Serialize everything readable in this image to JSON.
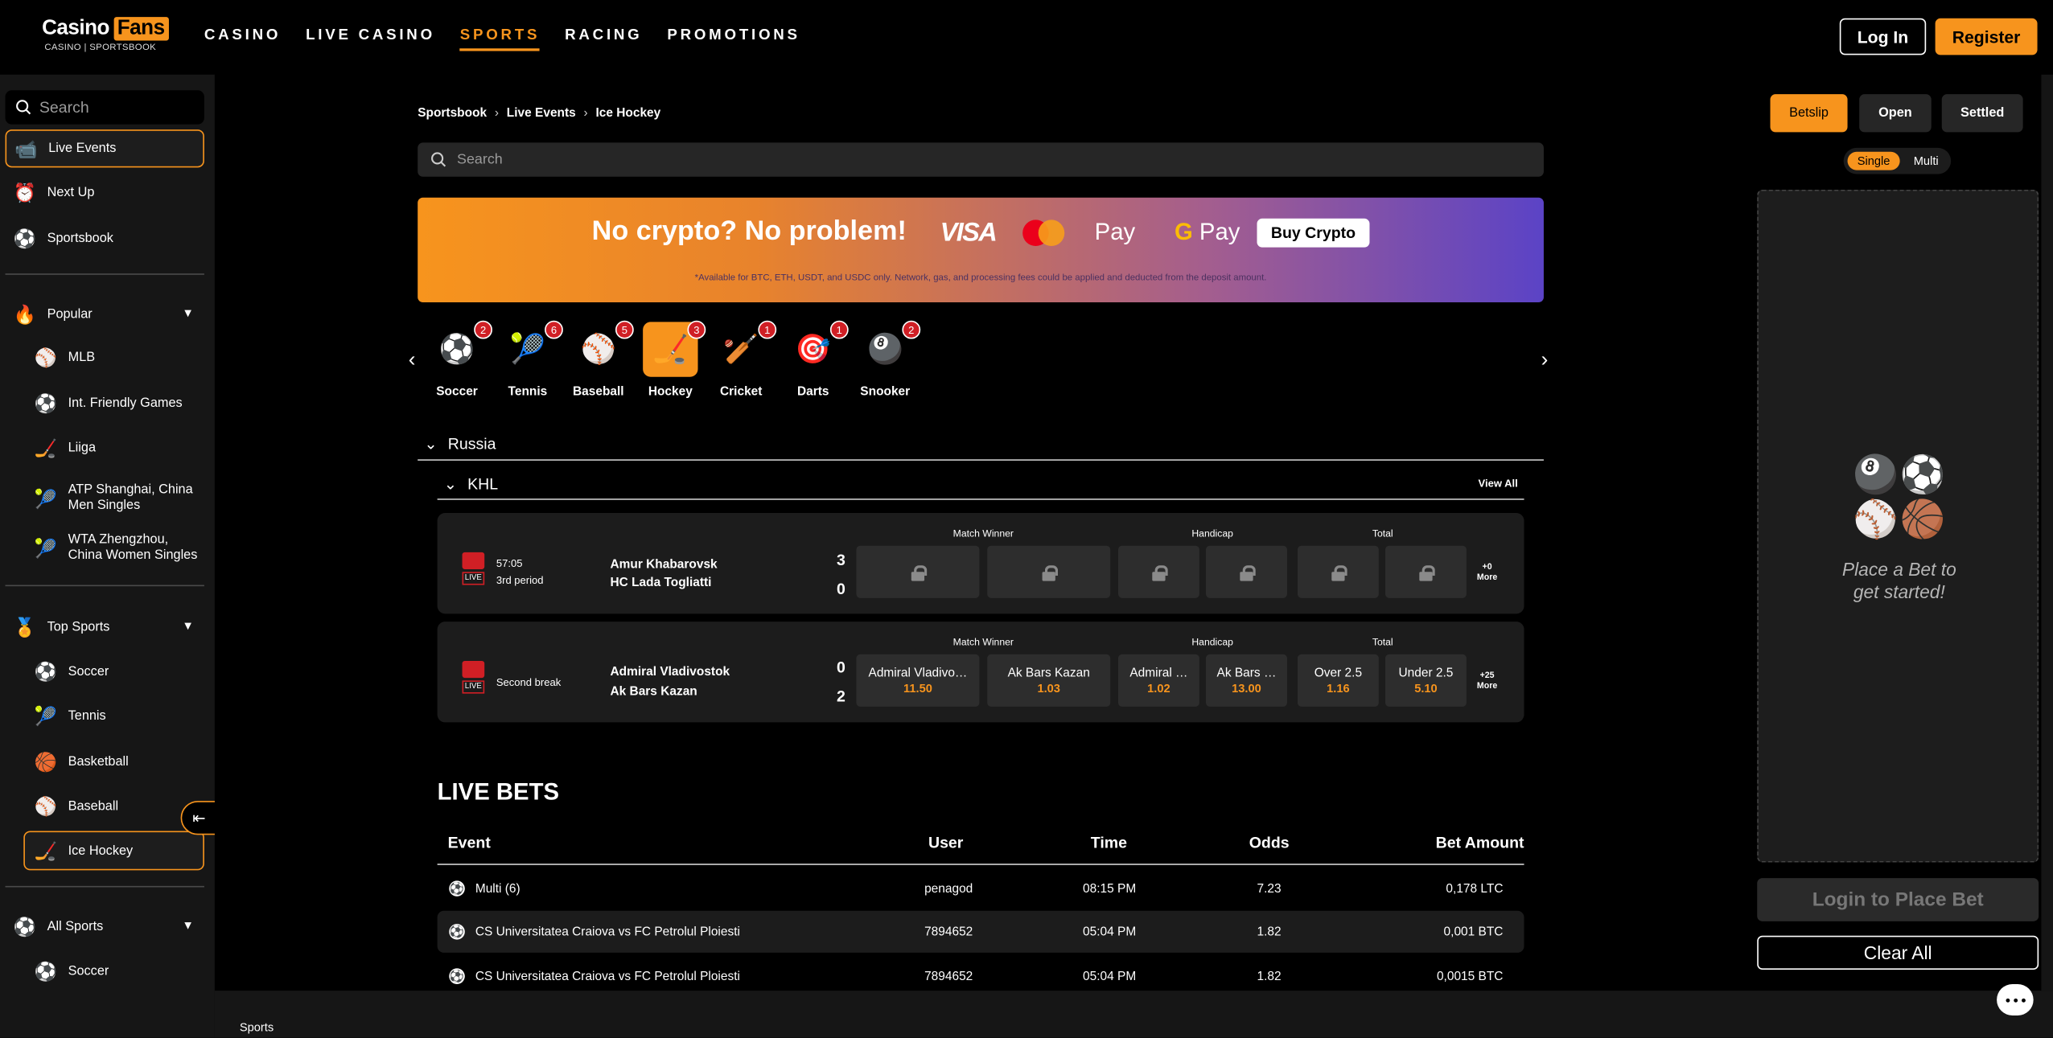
{
  "brand": {
    "name_part1": "Casino",
    "name_part2": "Fans",
    "tagline": "CASINO | SPORTSBOOK",
    "accent": "#f7941d"
  },
  "nav": {
    "items": [
      "CASINO",
      "LIVE CASINO",
      "SPORTS",
      "RACING",
      "PROMOTIONS"
    ],
    "active": "SPORTS"
  },
  "auth": {
    "login": "Log In",
    "register": "Register"
  },
  "sidebar": {
    "search_placeholder": "Search",
    "top_items": [
      {
        "label": "Live Events",
        "icon": "live-events-icon",
        "selected": true
      },
      {
        "label": "Next Up",
        "icon": "alarm-clock-icon"
      },
      {
        "label": "Sportsbook",
        "icon": "sports-balls-icon"
      }
    ],
    "popular": {
      "title": "Popular",
      "items": [
        {
          "label": "MLB",
          "icon": "baseball-icon"
        },
        {
          "label": "Int. Friendly Games",
          "icon": "soccer-icon"
        },
        {
          "label": "Liiga",
          "icon": "hockey-icon"
        },
        {
          "label": "ATP Shanghai, China Men Singles",
          "icon": "tennis-icon"
        },
        {
          "label": "WTA Zhengzhou, China Women Singles",
          "icon": "tennis-icon"
        }
      ]
    },
    "top_sports": {
      "title": "Top Sports",
      "items": [
        {
          "label": "Soccer",
          "icon": "soccer-icon"
        },
        {
          "label": "Tennis",
          "icon": "tennis-icon"
        },
        {
          "label": "Basketball",
          "icon": "basketball-icon"
        },
        {
          "label": "Baseball",
          "icon": "baseball-icon"
        },
        {
          "label": "Ice Hockey",
          "icon": "hockey-icon",
          "selected": true
        }
      ]
    },
    "all_sports": {
      "title": "All Sports",
      "items": [
        {
          "label": "Soccer",
          "icon": "soccer-icon"
        }
      ]
    }
  },
  "breadcrumb": [
    "Sportsbook",
    "Live Events",
    "Ice Hockey"
  ],
  "main_search_placeholder": "Search",
  "banner": {
    "headline": "No crypto? No problem!",
    "visa": "VISA",
    "apple_pay": "Pay",
    "google_pay": "Pay",
    "button": "Buy Crypto",
    "fine_print": "*Available for BTC, ETH, USDT, and USDC only. Network, gas, and processing fees could be applied and deducted from the deposit amount."
  },
  "sports": [
    {
      "label": "Soccer",
      "count": "2",
      "icon": "soccer-icon"
    },
    {
      "label": "Tennis",
      "count": "6",
      "icon": "tennis-icon"
    },
    {
      "label": "Baseball",
      "count": "5",
      "icon": "baseball-icon"
    },
    {
      "label": "Hockey",
      "count": "3",
      "icon": "hockey-icon",
      "active": true
    },
    {
      "label": "Cricket",
      "count": "1",
      "icon": "cricket-icon"
    },
    {
      "label": "Darts",
      "count": "1",
      "icon": "darts-icon"
    },
    {
      "label": "Snooker",
      "count": "2",
      "icon": "snooker-icon"
    }
  ],
  "region": "Russia",
  "league": {
    "name": "KHL",
    "view_all": "View All"
  },
  "market_headers": {
    "winner": "Match Winner",
    "handicap": "Handicap",
    "total": "Total"
  },
  "matches": [
    {
      "live_tag": "LIVE",
      "clock": "57:05",
      "period": "3rd period",
      "home": "Amur Khabarovsk",
      "away": "HC Lada Togliatti",
      "home_score": "3",
      "away_score": "0",
      "locked": true,
      "more": [
        "+0",
        "More"
      ]
    },
    {
      "live_tag": "LIVE",
      "period": "Second break",
      "home": "Admiral Vladivostok",
      "away": "Ak Bars Kazan",
      "home_score": "0",
      "away_score": "2",
      "locked": false,
      "odds": [
        {
          "label": "Admiral Vladivo…",
          "price": "11.50"
        },
        {
          "label": "Ak Bars Kazan",
          "price": "1.03"
        },
        {
          "label": "Admiral …",
          "price": "1.02"
        },
        {
          "label": "Ak Bars …",
          "price": "13.00"
        },
        {
          "label": "Over 2.5",
          "price": "1.16"
        },
        {
          "label": "Under 2.5",
          "price": "5.10"
        }
      ],
      "more": [
        "+25",
        "More"
      ]
    }
  ],
  "live_bets": {
    "title": "LIVE BETS",
    "columns": [
      "Event",
      "User",
      "Time",
      "Odds",
      "Bet Amount"
    ],
    "rows": [
      {
        "event": "Multi (6)",
        "user": "penagod",
        "time": "08:15 PM",
        "odds": "7.23",
        "amount": "0,178 LTC"
      },
      {
        "event": "CS Universitatea Craiova vs FC Petrolul Ploiesti",
        "user": "7894652",
        "time": "05:04 PM",
        "odds": "1.82",
        "amount": "0,001 BTC"
      },
      {
        "event": "CS Universitatea Craiova vs FC Petrolul Ploiesti",
        "user": "7894652",
        "time": "05:04 PM",
        "odds": "1.82",
        "amount": "0,0015 BTC"
      }
    ]
  },
  "betslip": {
    "tabs": [
      "Betslip",
      "Open",
      "Settled"
    ],
    "active_tab": "Betslip",
    "modes": [
      "Single",
      "Multi"
    ],
    "active_mode": "Single",
    "empty_message": "Place a Bet to get started!",
    "login_button": "Login to Place Bet",
    "clear_button": "Clear All"
  },
  "footer": {
    "label": "Sports"
  }
}
